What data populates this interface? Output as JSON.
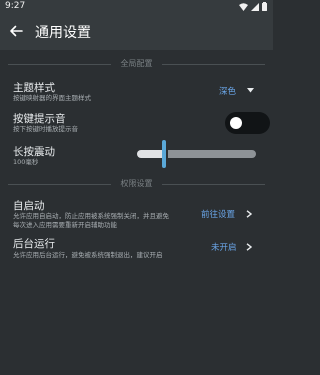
{
  "statusbar": {
    "time": "9:27"
  },
  "appbar": {
    "title": "通用设置"
  },
  "sections": {
    "global": "全局配置",
    "permission": "权限设置"
  },
  "theme": {
    "title": "主题样式",
    "subtitle": "按键映射器的界面主题样式",
    "value": "深色"
  },
  "keysound": {
    "title": "按键提示音",
    "subtitle": "按下按键时播放提示音",
    "enabled": false
  },
  "vibration": {
    "title": "长按震动",
    "value_text": "100毫秒",
    "level": 0.22
  },
  "autostart": {
    "title": "自启动",
    "subtitle_line1": "允许应用自启动，防止应用被系统强制关闭，并且避免",
    "subtitle_line2": "每次进入应用需要重新开启辅助功能",
    "action": "前往设置"
  },
  "background": {
    "title": "后台运行",
    "subtitle": "允许应用后台运行，避免被系统强制退出，建议开启",
    "action": "未开启"
  },
  "colors": {
    "background": "#2b2f32",
    "appbar": "#363b3e",
    "accent": "#6aa6e8",
    "slider_thumb": "#5aa8d8"
  }
}
